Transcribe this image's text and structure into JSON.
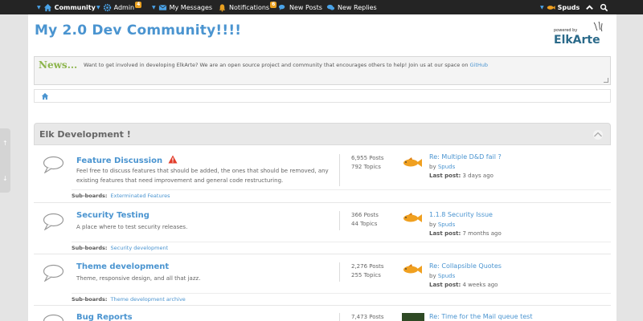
{
  "topbar": {
    "community": "Community",
    "admin": "Admin",
    "admin_badge": "4",
    "messages": "My Messages",
    "notifications": "Notifications",
    "notifications_badge": "6",
    "new_posts": "New Posts",
    "new_replies": "New Replies",
    "user": "Spuds"
  },
  "header": {
    "title": "My 2.0 Dev Community!!!!",
    "logo_small": "powered by",
    "logo_text": "ElkArte"
  },
  "news": {
    "label": "News...",
    "text": "Want to get involved in developing ElkArte?  We are an open source project and community that encourages others to help! Join us at our space on ",
    "link": "GitHub"
  },
  "category": {
    "title": "Elk Development !"
  },
  "boards": [
    {
      "name": "Feature Discussion",
      "desc": "Feel free to discuss features that should be added, the ones that should be removed,  any existing features that need improvement and general code restructuring.",
      "posts": "6,955 Posts",
      "topics": "792 Topics",
      "last_topic": "Re: Multiple D&D fail ?",
      "by_label": "by",
      "last_user": "Spuds",
      "last_post_label": "Last post:",
      "last_post_time": "3 days ago",
      "subboards_label": "Sub-boards:",
      "subboards": "Exterminated Features"
    },
    {
      "name": "Security Testing",
      "desc": "A place where to test security releases.",
      "posts": "366 Posts",
      "topics": "44 Topics",
      "last_topic": "1.1.8 Security Issue",
      "by_label": "by",
      "last_user": "Spuds",
      "last_post_label": "Last post:",
      "last_post_time": "7 months ago",
      "subboards_label": "Sub-boards:",
      "subboards": "Security development"
    },
    {
      "name": "Theme development",
      "desc": "Theme, responsive design, and all that jazz.",
      "posts": "2,276 Posts",
      "topics": "255 Topics",
      "last_topic": "Re: Collapsible Quotes",
      "by_label": "by",
      "last_user": "Spuds",
      "last_post_label": "Last post:",
      "last_post_time": "4 weeks ago",
      "subboards_label": "Sub-boards:",
      "subboards": "Theme development archive"
    },
    {
      "name": "Bug Reports",
      "posts": "7,473 Posts",
      "last_topic": "Re: Time for the Mail queue test"
    }
  ]
}
